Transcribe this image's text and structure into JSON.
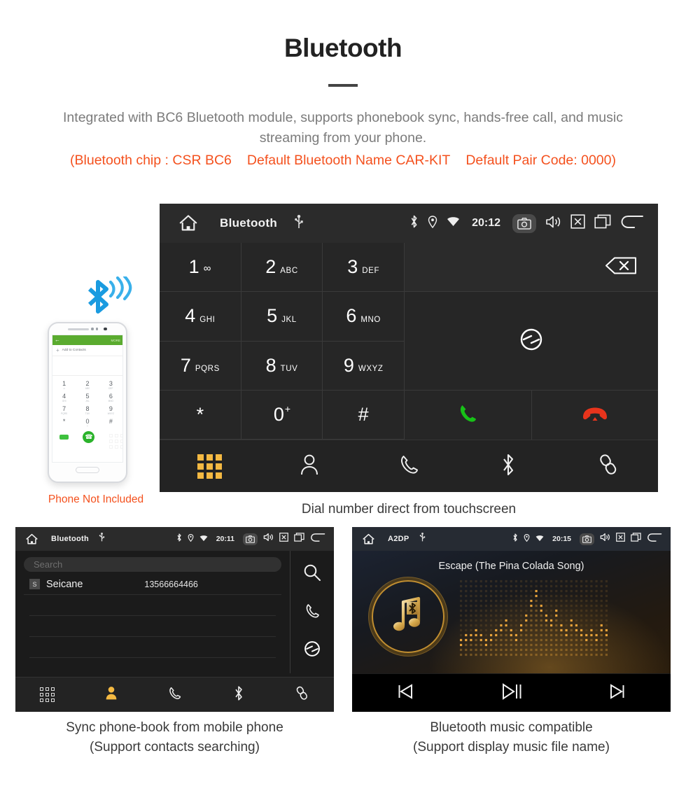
{
  "header": {
    "title": "Bluetooth",
    "description": "Integrated with BC6 Bluetooth module, supports phonebook sync, hands-free call, and music streaming from your phone.",
    "spec_chip": "(Bluetooth chip : CSR BC6",
    "spec_name": "Default Bluetooth Name CAR-KIT",
    "spec_pair": "Default Pair Code: 0000)",
    "accent_color": "#f4511e",
    "text_color": "#7b7b7b"
  },
  "main_screen": {
    "statusbar": {
      "home_icon": "home-icon",
      "title": "Bluetooth",
      "usb_icon": "usb-icon",
      "bluetooth_icon": "bluetooth-icon",
      "location_icon": "location-icon",
      "wifi_icon": "wifi-icon",
      "clock": "20:12",
      "camera_icon": "camera-icon",
      "volume_icon": "volume-icon",
      "close_icon": "close-box-icon",
      "recents_icon": "recents-icon",
      "back_icon": "back-icon"
    },
    "keys": [
      {
        "digit": "1",
        "sub": "∞",
        "sub_kind": "voicemail"
      },
      {
        "digit": "2",
        "sub": "ABC",
        "sub_kind": "letters"
      },
      {
        "digit": "3",
        "sub": "DEF",
        "sub_kind": "letters"
      },
      {
        "digit": "4",
        "sub": "GHI",
        "sub_kind": "letters"
      },
      {
        "digit": "5",
        "sub": "JKL",
        "sub_kind": "letters"
      },
      {
        "digit": "6",
        "sub": "MNO",
        "sub_kind": "letters"
      },
      {
        "digit": "7",
        "sub": "PQRS",
        "sub_kind": "letters"
      },
      {
        "digit": "8",
        "sub": "TUV",
        "sub_kind": "letters"
      },
      {
        "digit": "9",
        "sub": "WXYZ",
        "sub_kind": "letters"
      },
      {
        "digit": "*",
        "sub": "",
        "sub_kind": "none"
      },
      {
        "digit": "0",
        "sub": "+",
        "sub_kind": "plus"
      },
      {
        "digit": "#",
        "sub": "",
        "sub_kind": "none"
      }
    ],
    "backspace_icon": "backspace-icon",
    "sync_icon": "sync-icon",
    "call_icon": "call-icon",
    "call_color": "#17c117",
    "hangup_icon": "hangup-icon",
    "hangup_color": "#e8341c",
    "tabs": [
      {
        "name": "dialpad",
        "icon": "dialpad-icon",
        "active": true
      },
      {
        "name": "contacts",
        "icon": "person-icon",
        "active": false
      },
      {
        "name": "call-log",
        "icon": "handset-icon",
        "active": false
      },
      {
        "name": "bluetooth",
        "icon": "bluetooth-icon",
        "active": false
      },
      {
        "name": "pair-link",
        "icon": "link-icon",
        "active": false
      }
    ],
    "active_tab_color": "#f4b942"
  },
  "phone_art": {
    "bluetooth_wave_icon": "bluetooth-signal-icon",
    "wave_color": "#1a9be0",
    "screen_appbar_back_icon": "back-arrow-icon",
    "screen_appbar_more": "MORE",
    "screen_add_contacts": "Add to Contacts",
    "screen_keys": [
      {
        "digit": "1",
        "sub": "∞"
      },
      {
        "digit": "2",
        "sub": "ABC"
      },
      {
        "digit": "3",
        "sub": "DEF"
      },
      {
        "digit": "4",
        "sub": "GHI"
      },
      {
        "digit": "5",
        "sub": "JKL"
      },
      {
        "digit": "6",
        "sub": "MNO"
      },
      {
        "digit": "7",
        "sub": "PQRS"
      },
      {
        "digit": "8",
        "sub": "TUV"
      },
      {
        "digit": "9",
        "sub": "WXYZ"
      },
      {
        "digit": "*",
        "sub": ""
      },
      {
        "digit": "0",
        "sub": "+"
      },
      {
        "digit": "#",
        "sub": ""
      }
    ],
    "call_button_icon": "call-icon",
    "disclaimer": "Phone Not Included"
  },
  "captions": {
    "main": "Dial number direct from touchscreen",
    "phonebook_line1": "Sync phone-book from mobile phone",
    "phonebook_line2": "(Support contacts searching)",
    "music_line1": "Bluetooth music compatible",
    "music_line2": "(Support display music file name)"
  },
  "phonebook_screen": {
    "statusbar": {
      "title": "Bluetooth",
      "clock": "20:11"
    },
    "search_placeholder": "Search",
    "contacts": [
      {
        "initial": "S",
        "name": "Seicane",
        "number": "13566664466"
      }
    ],
    "side_actions": [
      {
        "name": "search",
        "icon": "search-icon"
      },
      {
        "name": "call",
        "icon": "handset-icon"
      },
      {
        "name": "sync",
        "icon": "sync-icon"
      }
    ],
    "tabs": [
      {
        "name": "dialpad",
        "icon": "dialpad-icon",
        "active": false
      },
      {
        "name": "contacts",
        "icon": "person-icon",
        "active": true
      },
      {
        "name": "call-log",
        "icon": "handset-icon",
        "active": false
      },
      {
        "name": "bluetooth",
        "icon": "bluetooth-icon",
        "active": false
      },
      {
        "name": "pair-link",
        "icon": "link-icon",
        "active": false
      }
    ]
  },
  "music_screen": {
    "statusbar": {
      "title": "A2DP",
      "clock": "20:15"
    },
    "track_title": "Escape (The Pina Colada Song)",
    "album_icon": "music-note-bluetooth-icon",
    "visualizer": {
      "type": "dot-matrix-spectrum",
      "columns": 30,
      "rows": 16,
      "levels": [
        4,
        5,
        5,
        6,
        5,
        4,
        5,
        6,
        7,
        8,
        6,
        5,
        7,
        9,
        12,
        14,
        11,
        9,
        8,
        10,
        7,
        6,
        8,
        7,
        6,
        5,
        6,
        5,
        7,
        6
      ],
      "dot_color": "#f0a93c"
    },
    "controls": [
      {
        "name": "previous",
        "icon": "skip-previous-icon"
      },
      {
        "name": "play-pause",
        "icon": "play-pause-icon"
      },
      {
        "name": "next",
        "icon": "skip-next-icon"
      }
    ]
  }
}
